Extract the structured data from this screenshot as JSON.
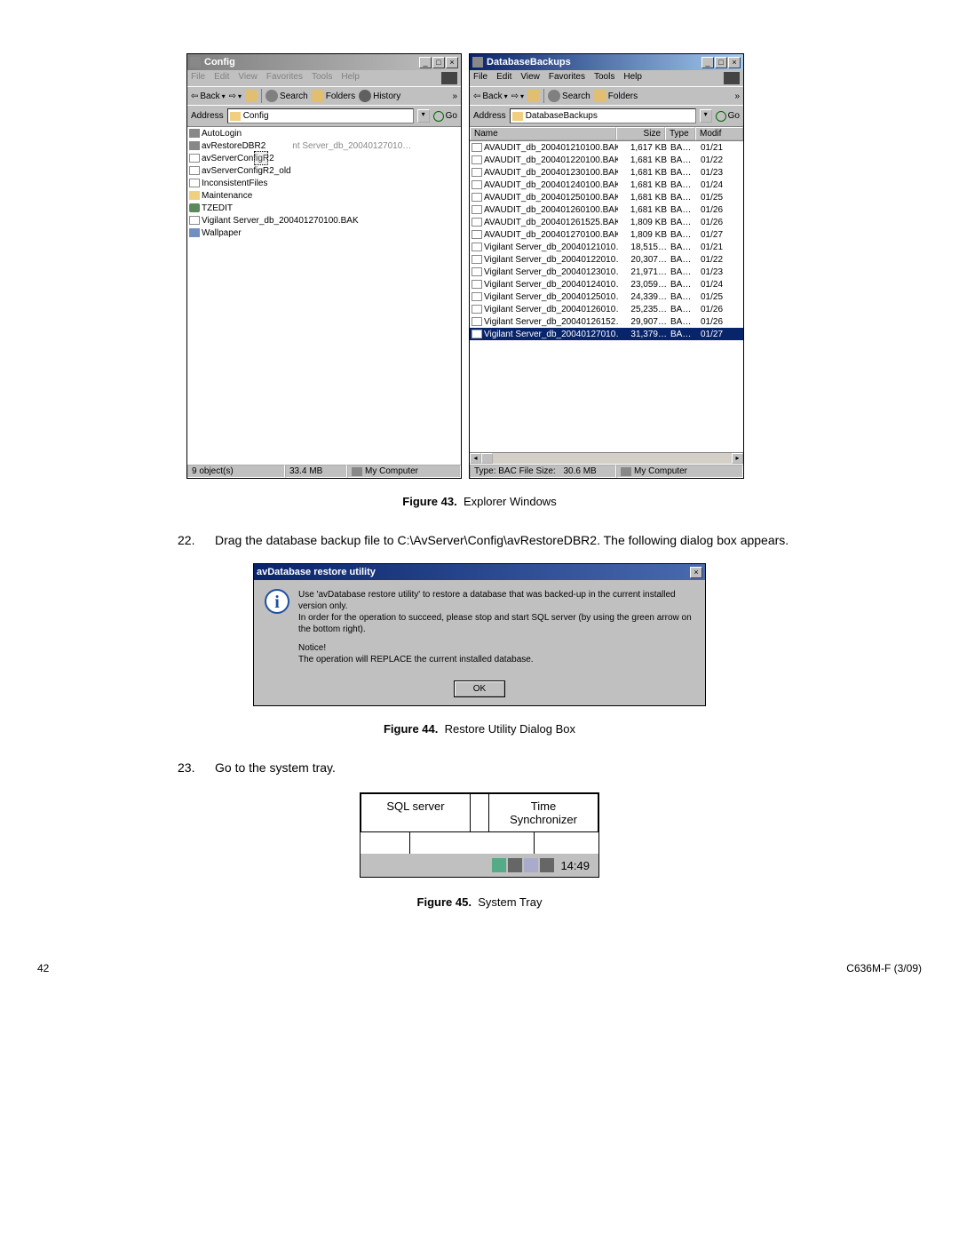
{
  "win1": {
    "title": "Config",
    "menu": [
      "File",
      "Edit",
      "View",
      "Favorites",
      "Tools",
      "Help"
    ],
    "toolbar": {
      "back": "Back",
      "search": "Search",
      "folders": "Folders",
      "history": "History"
    },
    "address_label": "Address",
    "address_value": "Config",
    "go": "Go",
    "items": [
      {
        "icon": "exe",
        "name": "AutoLogin"
      },
      {
        "icon": "exe",
        "name": "avRestoreDBR2",
        "drag_label": "nt Server_db_20040127010…",
        "dragging": true
      },
      {
        "icon": "file",
        "name": "avServerConfigR2"
      },
      {
        "icon": "file",
        "name": "avServerConfigR2_old"
      },
      {
        "icon": "file",
        "name": "InconsistentFiles"
      },
      {
        "icon": "folder",
        "name": "Maintenance"
      },
      {
        "icon": "reg",
        "name": "TZEDIT"
      },
      {
        "icon": "file",
        "name": "Vigilant Server_db_200401270100.BAK"
      },
      {
        "icon": "img",
        "name": "Wallpaper"
      }
    ],
    "status": {
      "objects": "9 object(s)",
      "size": "33.4 MB",
      "location": "My Computer"
    }
  },
  "win2": {
    "title": "DatabaseBackups",
    "menu": [
      "File",
      "Edit",
      "View",
      "Favorites",
      "Tools",
      "Help"
    ],
    "toolbar": {
      "back": "Back",
      "search": "Search",
      "folders": "Folders"
    },
    "address_label": "Address",
    "address_value": "DatabaseBackups",
    "go": "Go",
    "headers": [
      "Name",
      "Size",
      "Type",
      "Modif"
    ],
    "rows": [
      {
        "name": "AVAUDIT_db_200401210100.BAK",
        "size": "1,617 KB",
        "type": "BA…",
        "mod": "01/21"
      },
      {
        "name": "AVAUDIT_db_200401220100.BAK",
        "size": "1,681 KB",
        "type": "BA…",
        "mod": "01/22"
      },
      {
        "name": "AVAUDIT_db_200401230100.BAK",
        "size": "1,681 KB",
        "type": "BA…",
        "mod": "01/23"
      },
      {
        "name": "AVAUDIT_db_200401240100.BAK",
        "size": "1,681 KB",
        "type": "BA…",
        "mod": "01/24"
      },
      {
        "name": "AVAUDIT_db_200401250100.BAK",
        "size": "1,681 KB",
        "type": "BA…",
        "mod": "01/25"
      },
      {
        "name": "AVAUDIT_db_200401260100.BAK",
        "size": "1,681 KB",
        "type": "BA…",
        "mod": "01/26"
      },
      {
        "name": "AVAUDIT_db_200401261525.BAK",
        "size": "1,809 KB",
        "type": "BA…",
        "mod": "01/26"
      },
      {
        "name": "AVAUDIT_db_200401270100.BAK",
        "size": "1,809 KB",
        "type": "BA…",
        "mod": "01/27"
      },
      {
        "name": "Vigilant Server_db_20040121010…",
        "size": "18,515…",
        "type": "BA…",
        "mod": "01/21"
      },
      {
        "name": "Vigilant Server_db_20040122010…",
        "size": "20,307…",
        "type": "BA…",
        "mod": "01/22"
      },
      {
        "name": "Vigilant Server_db_20040123010…",
        "size": "21,971…",
        "type": "BA…",
        "mod": "01/23"
      },
      {
        "name": "Vigilant Server_db_20040124010…",
        "size": "23,059…",
        "type": "BA…",
        "mod": "01/24"
      },
      {
        "name": "Vigilant Server_db_20040125010…",
        "size": "24,339…",
        "type": "BA…",
        "mod": "01/25"
      },
      {
        "name": "Vigilant Server_db_20040126010…",
        "size": "25,235…",
        "type": "BA…",
        "mod": "01/26"
      },
      {
        "name": "Vigilant Server_db_20040126152…",
        "size": "29,907…",
        "type": "BA…",
        "mod": "01/26"
      },
      {
        "name": "Vigilant Server_db_20040127010…",
        "size": "31,379…",
        "type": "BA…",
        "mod": "01/27",
        "selected": true
      }
    ],
    "status": {
      "type_label": "Type: BAC File Size:",
      "size": "30.6 MB",
      "location": "My Computer"
    }
  },
  "fig43": {
    "label": "Figure 43.",
    "text": "Explorer Windows"
  },
  "step22": {
    "num": "22.",
    "text": "Drag the database backup file to C:\\AvServer\\Config\\avRestoreDBR2. The following dialog box appears."
  },
  "dialog": {
    "title": "avDatabase restore utility",
    "p1": "Use 'avDatabase restore utility' to restore a database that was backed-up in the current installed version only.",
    "p2": "In order for the operation to succeed, please stop and start SQL server (by using the green arrow on the bottom right).",
    "p3": "Notice!",
    "p4": "The operation will REPLACE the current installed database.",
    "ok": "OK"
  },
  "fig44": {
    "label": "Figure 44.",
    "text": "Restore Utility Dialog Box"
  },
  "step23": {
    "num": "23.",
    "text": "Go to the system tray."
  },
  "tray": {
    "label1": "SQL server",
    "label2": "Time Synchronizer",
    "clock": "14:49"
  },
  "fig45": {
    "label": "Figure 45.",
    "text": "System Tray"
  },
  "footer": {
    "page": "42",
    "doc": "C636M-F (3/09)"
  }
}
